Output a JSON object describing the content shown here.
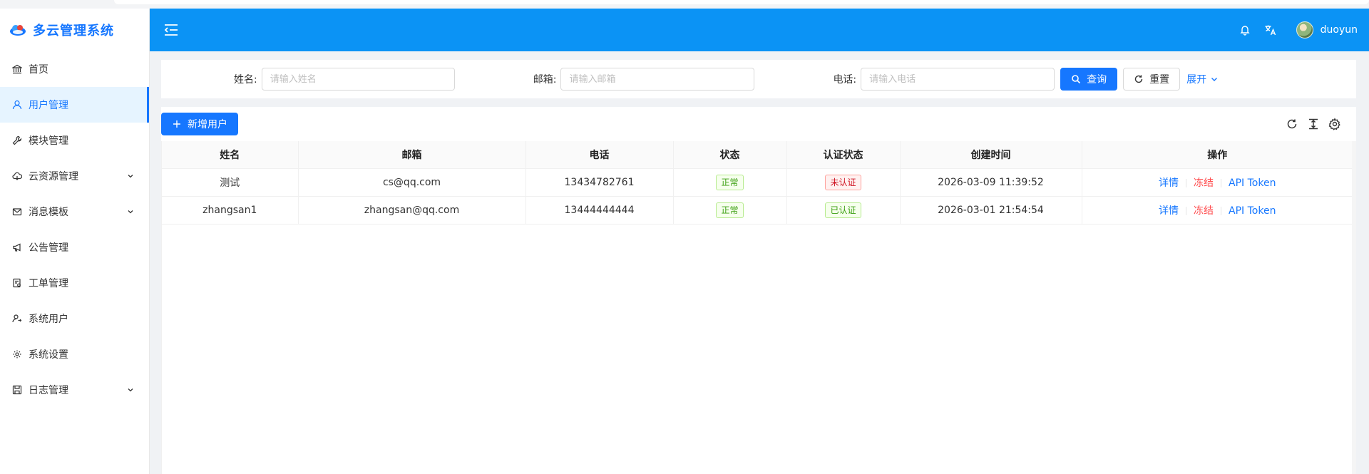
{
  "app": {
    "title": "多云管理系统"
  },
  "sidebar": {
    "items": [
      {
        "label": "首页",
        "icon": "bank-icon",
        "has_arrow": false,
        "active": false
      },
      {
        "label": "用户管理",
        "icon": "user-icon",
        "has_arrow": false,
        "active": true
      },
      {
        "label": "模块管理",
        "icon": "tool-icon",
        "has_arrow": false,
        "active": false
      },
      {
        "label": "云资源管理",
        "icon": "cloud-icon",
        "has_arrow": true,
        "active": false
      },
      {
        "label": "消息模板",
        "icon": "mail-icon",
        "has_arrow": true,
        "active": false
      },
      {
        "label": "公告管理",
        "icon": "megaphone-icon",
        "has_arrow": false,
        "active": false
      },
      {
        "label": "工单管理",
        "icon": "ticket-icon",
        "has_arrow": false,
        "active": false
      },
      {
        "label": "系统用户",
        "icon": "user-switch-icon",
        "has_arrow": false,
        "active": false
      },
      {
        "label": "系统设置",
        "icon": "gear-icon",
        "has_arrow": false,
        "active": false
      },
      {
        "label": "日志管理",
        "icon": "save-icon",
        "has_arrow": true,
        "active": false
      }
    ]
  },
  "header": {
    "username": "duoyun"
  },
  "search": {
    "name_label": "姓名:",
    "name_placeholder": "请输入姓名",
    "email_label": "邮箱:",
    "email_placeholder": "请输入邮箱",
    "phone_label": "电话:",
    "phone_placeholder": "请输入电话",
    "query_label": "查询",
    "reset_label": "重置",
    "expand_label": "展开"
  },
  "toolbar": {
    "add_label": "新增用户"
  },
  "table": {
    "columns": [
      "姓名",
      "邮箱",
      "电话",
      "状态",
      "认证状态",
      "创建时间",
      "操作"
    ],
    "rows": [
      {
        "name": "测试",
        "email": "cs@qq.com",
        "phone": "13434782761",
        "status": "正常",
        "auth": "未认证",
        "created": "2026-03-09 11:39:52"
      },
      {
        "name": "zhangsan1",
        "email": "zhangsan@qq.com",
        "phone": "13444444444",
        "status": "正常",
        "auth": "已认证",
        "created": "2026-03-01 21:54:54"
      }
    ],
    "actions": {
      "detail": "详情",
      "freeze": "冻结",
      "token": "API Token"
    }
  },
  "colors": {
    "brand": "#1677ff",
    "header": "#0b93f5",
    "success": "#389e0d",
    "error": "#cf1322",
    "danger": "#ff4d4f"
  }
}
